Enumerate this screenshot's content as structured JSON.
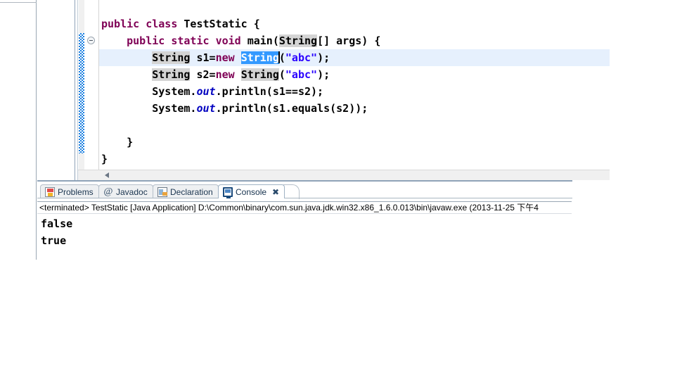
{
  "editor": {
    "lines": [
      {
        "indent": 0,
        "current": false,
        "tokens": [
          {
            "t": "public",
            "c": "kw"
          },
          {
            "t": " ",
            "c": "plain"
          },
          {
            "t": "class",
            "c": "kw"
          },
          {
            "t": " ",
            "c": "plain"
          },
          {
            "t": "TestStatic",
            "c": "cls"
          },
          {
            "t": " {",
            "c": "plain"
          }
        ]
      },
      {
        "indent": 0,
        "current": false,
        "tokens": [
          {
            "t": "    ",
            "c": "plain"
          },
          {
            "t": "public",
            "c": "kw"
          },
          {
            "t": " ",
            "c": "plain"
          },
          {
            "t": "static",
            "c": "kw"
          },
          {
            "t": " ",
            "c": "plain"
          },
          {
            "t": "void",
            "c": "kw"
          },
          {
            "t": " ",
            "c": "plain"
          },
          {
            "t": "main",
            "c": "plain"
          },
          {
            "t": "(",
            "c": "plain"
          },
          {
            "t": "String",
            "c": "cls occ"
          },
          {
            "t": "[] args) {",
            "c": "plain"
          }
        ]
      },
      {
        "indent": 0,
        "current": true,
        "tokens": [
          {
            "t": "        ",
            "c": "plain"
          },
          {
            "t": "String",
            "c": "cls occ"
          },
          {
            "t": " s1=",
            "c": "plain"
          },
          {
            "t": "new",
            "c": "kw"
          },
          {
            "t": " ",
            "c": "plain"
          },
          {
            "t": "String",
            "c": "cls sel"
          },
          {
            "t": "CARET",
            "c": "caret"
          },
          {
            "t": "(",
            "c": "plain"
          },
          {
            "t": "\"abc\"",
            "c": "str"
          },
          {
            "t": ");",
            "c": "plain"
          }
        ]
      },
      {
        "indent": 0,
        "current": false,
        "tokens": [
          {
            "t": "        ",
            "c": "plain"
          },
          {
            "t": "String",
            "c": "cls occ"
          },
          {
            "t": " s2=",
            "c": "plain"
          },
          {
            "t": "new",
            "c": "kw"
          },
          {
            "t": " ",
            "c": "plain"
          },
          {
            "t": "String",
            "c": "cls occ"
          },
          {
            "t": "(",
            "c": "plain"
          },
          {
            "t": "\"abc\"",
            "c": "str"
          },
          {
            "t": ");",
            "c": "plain"
          }
        ]
      },
      {
        "indent": 0,
        "current": false,
        "tokens": [
          {
            "t": "        System.",
            "c": "plain"
          },
          {
            "t": "out",
            "c": "fld"
          },
          {
            "t": ".println(s1==s2);",
            "c": "plain"
          }
        ]
      },
      {
        "indent": 0,
        "current": false,
        "tokens": [
          {
            "t": "        System.",
            "c": "plain"
          },
          {
            "t": "out",
            "c": "fld"
          },
          {
            "t": ".println(s1.equals(s2));",
            "c": "plain"
          }
        ]
      },
      {
        "indent": 0,
        "current": false,
        "tokens": []
      },
      {
        "indent": 0,
        "current": false,
        "tokens": [
          {
            "t": "    }",
            "c": "plain"
          }
        ]
      },
      {
        "indent": 0,
        "current": false,
        "tokens": [
          {
            "t": "}",
            "c": "plain"
          }
        ]
      }
    ],
    "fold_markers": [
      {
        "line": 1
      }
    ]
  },
  "bottom_panel": {
    "tabs": [
      {
        "label": "Problems",
        "icon": "problems-icon",
        "active": false,
        "closable": false
      },
      {
        "label": "Javadoc",
        "icon": "javadoc-icon",
        "active": false,
        "closable": false,
        "glyph": "@"
      },
      {
        "label": "Declaration",
        "icon": "declaration-icon",
        "active": false,
        "closable": false
      },
      {
        "label": "Console",
        "icon": "console-icon",
        "active": true,
        "closable": true,
        "close_glyph": "✖"
      }
    ],
    "launch_line": "<terminated> TestStatic [Java Application] D:\\Common\\binary\\com.sun.java.jdk.win32.x86_1.6.0.013\\bin\\javaw.exe (2013-11-25 下午4",
    "console_output": "false\ntrue"
  },
  "colors": {
    "keyword": "#7f0055",
    "string": "#2a00ff",
    "static_field": "#0000c0",
    "occurrence_highlight": "#d4d4d4",
    "selection": "#3399ff",
    "current_line": "#e6f0fd",
    "change_bar": "#1b7fe0"
  }
}
